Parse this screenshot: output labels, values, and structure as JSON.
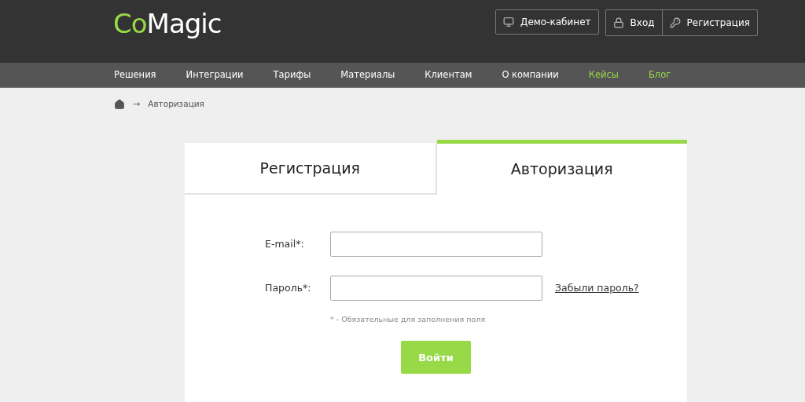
{
  "logo": {
    "accent": "Co",
    "rest": "Magic"
  },
  "header_buttons": [
    {
      "kind": "monitor",
      "label": "Демо-кабинет"
    },
    {
      "kind": "lock",
      "label": "Вход"
    },
    {
      "kind": "key",
      "label": "Регистрация"
    }
  ],
  "nav": [
    {
      "label": "Решения",
      "highlighted": false
    },
    {
      "label": "Интеграции",
      "highlighted": false
    },
    {
      "label": "Тарифы",
      "highlighted": false
    },
    {
      "label": "Материалы",
      "highlighted": false
    },
    {
      "label": "Клиентам",
      "highlighted": false
    },
    {
      "label": "О компании",
      "highlighted": false
    },
    {
      "label": "Кейсы",
      "highlighted": true
    },
    {
      "label": "Блог",
      "highlighted": true
    }
  ],
  "breadcrumb": {
    "separator": "→",
    "current": "Авторизация"
  },
  "tabs": [
    {
      "label": "Регистрация",
      "selected": false
    },
    {
      "label": "Авторизация",
      "selected": true
    }
  ],
  "fields": [
    {
      "label": "E-mail*:"
    },
    {
      "label": "Пароль*:",
      "link": "Забыли пароль?"
    }
  ],
  "note": "* - Обязательные для заполнения поля",
  "submit": "Войти"
}
